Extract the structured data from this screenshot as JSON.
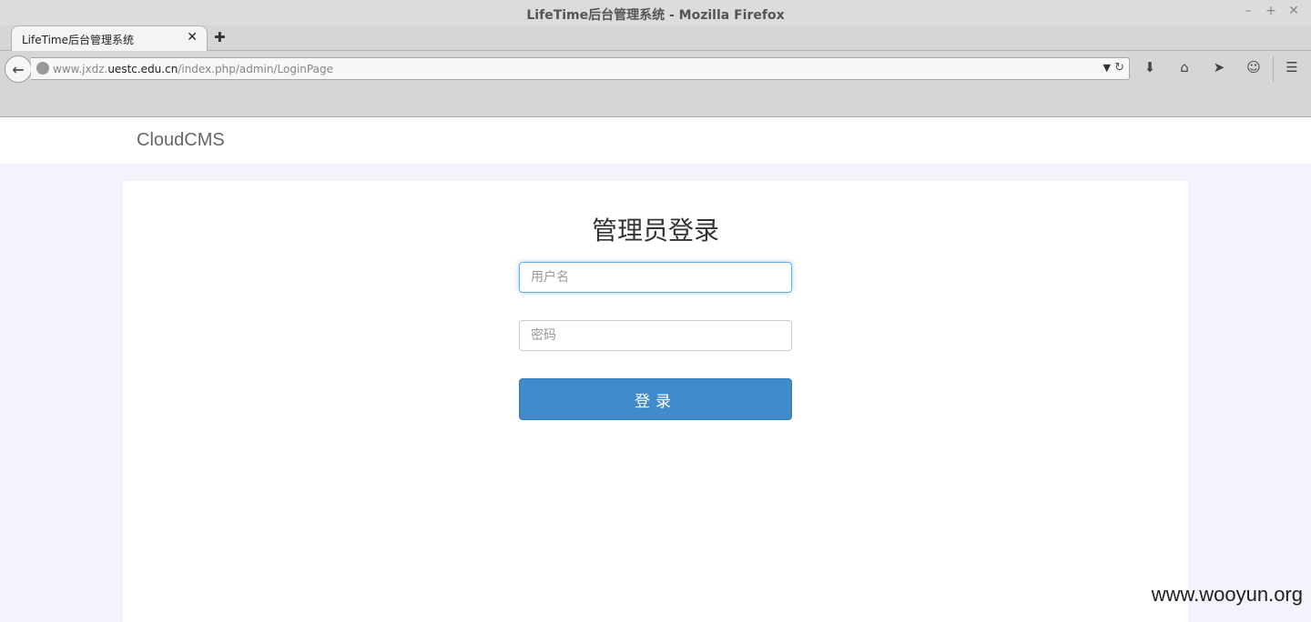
{
  "browser": {
    "window_title": "LifeTime后台管理系统 - Mozilla Firefox",
    "controls": {
      "minimize": "–",
      "maximize": "+",
      "close": "✕"
    },
    "tab": {
      "label": "LifeTime后台管理系统",
      "close": "✕"
    },
    "new_tab": "✚",
    "url": {
      "prefix": "www.jxdz.",
      "host": "uestc.edu.cn",
      "path": "/index.php/admin/LoginPage"
    },
    "toolbar_icons": [
      "download-icon",
      "home-icon",
      "send-icon",
      "smiley-icon",
      "menu-icon"
    ]
  },
  "site": {
    "brand": "CloudCMS"
  },
  "login": {
    "title": "管理员登录",
    "username_placeholder": "用户名",
    "password_placeholder": "密码",
    "submit_label": "登录"
  },
  "watermark": "www.wooyun.org",
  "colors": {
    "accent": "#428bca",
    "page_bg": "#f3f3fb"
  }
}
